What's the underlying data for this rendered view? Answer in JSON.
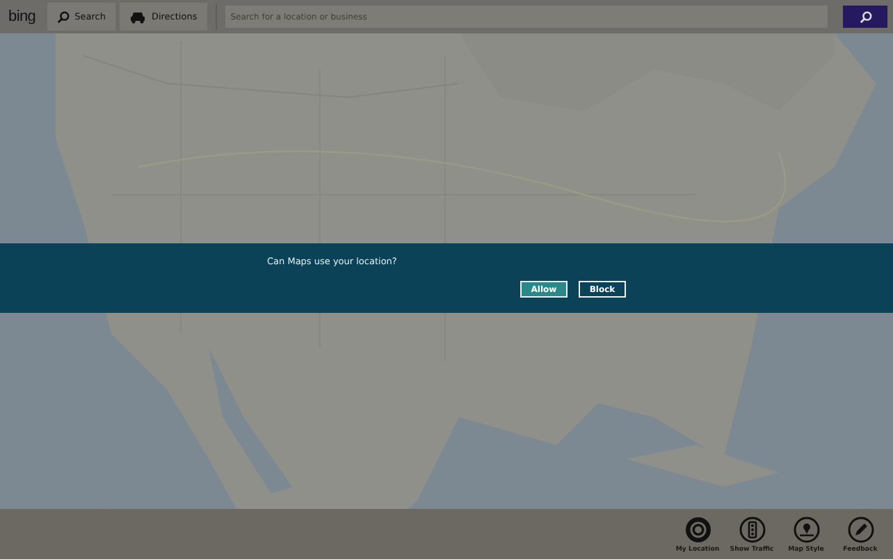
{
  "top_bar": {
    "logo": "bing",
    "nav": [
      {
        "label": "Search"
      },
      {
        "label": "Directions"
      }
    ],
    "search": {
      "placeholder": "Search for a location or business"
    }
  },
  "location_prompt": {
    "message": "Can Maps use your location?",
    "buttons": [
      {
        "label": "Allow",
        "kind": "primary"
      },
      {
        "label": "Block",
        "kind": "secondary"
      }
    ]
  },
  "app_bar": [
    {
      "label": "My Location"
    },
    {
      "label": "Show Traffic"
    },
    {
      "label": "Map Style"
    },
    {
      "label": "Feedback"
    }
  ]
}
